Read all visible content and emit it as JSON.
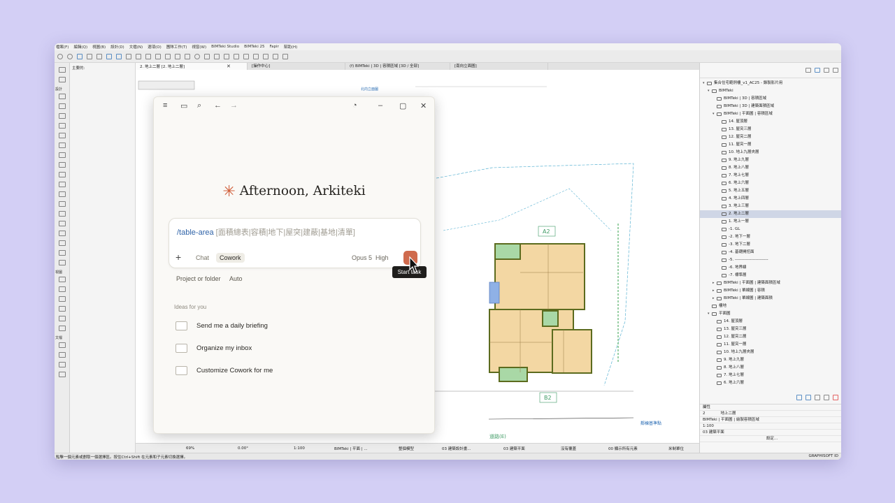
{
  "menubar": [
    "檔案(F)",
    "編輯(Q)",
    "視圖(B)",
    "設計(D)",
    "文檔(N)",
    "選項(O)",
    "團隊工作(T)",
    "視窗(W)",
    "BIMTeki Studio",
    "BIMTeki 25",
    "Fapir",
    "幫助(H)"
  ],
  "tabs": {
    "view_tab": "2. 地上二層 [2. 地上二層]",
    "tab_action": "[操作中心]",
    "tab_3d": "(f) BIMTeki | 3D | 容積區域 [3D / 全部]",
    "tab_elevation": "[南向立面圖]"
  },
  "infobox": {
    "title": "主要的:"
  },
  "left_palette_labels": [
    "設計",
    "文檔",
    "視圖"
  ],
  "canvas": {
    "elevation_marker": "北向立面圖",
    "labels": [
      "A2",
      "B2",
      "鄰棟基準點",
      "道路(E)"
    ]
  },
  "right_panel": {
    "project": "集合住宅範例樓_v1_AC25 - 錄製影片用",
    "tree": [
      {
        "label": "BIMTeki",
        "indent": 1,
        "arrow": "▾"
      },
      {
        "label": "BIMTeki | 3D | 容積區域",
        "indent": 2,
        "arrow": ""
      },
      {
        "label": "BIMTeki | 3D | 建築面積區域",
        "indent": 2,
        "arrow": ""
      },
      {
        "label": "BIMTeki | 平面圖 | 容積區域",
        "indent": 2,
        "arrow": "▾"
      },
      {
        "label": "14. 屋頂層",
        "indent": 3,
        "arrow": ""
      },
      {
        "label": "13. 屋突三層",
        "indent": 3,
        "arrow": ""
      },
      {
        "label": "12. 屋突二層",
        "indent": 3,
        "arrow": ""
      },
      {
        "label": "11. 屋突一層",
        "indent": 3,
        "arrow": ""
      },
      {
        "label": "10. 地上九層夾層",
        "indent": 3,
        "arrow": ""
      },
      {
        "label": "9. 地上九層",
        "indent": 3,
        "arrow": ""
      },
      {
        "label": "8. 地上八層",
        "indent": 3,
        "arrow": ""
      },
      {
        "label": "7. 地上七層",
        "indent": 3,
        "arrow": ""
      },
      {
        "label": "6. 地上六層",
        "indent": 3,
        "arrow": ""
      },
      {
        "label": "5. 地上五層",
        "indent": 3,
        "arrow": ""
      },
      {
        "label": "4. 地上四層",
        "indent": 3,
        "arrow": ""
      },
      {
        "label": "3. 地上三層",
        "indent": 3,
        "arrow": ""
      },
      {
        "label": "2. 地上二層",
        "indent": 3,
        "arrow": "",
        "selected": true
      },
      {
        "label": "1. 地上一層",
        "indent": 3,
        "arrow": ""
      },
      {
        "label": "-1. GL",
        "indent": 3,
        "arrow": ""
      },
      {
        "label": "-2. 地下一層",
        "indent": 3,
        "arrow": ""
      },
      {
        "label": "-3. 地下二層",
        "indent": 3,
        "arrow": ""
      },
      {
        "label": "-4. 基礎開挖面",
        "indent": 3,
        "arrow": ""
      },
      {
        "label": "-5. ------------------------",
        "indent": 3,
        "arrow": ""
      },
      {
        "label": "-6. 地界線",
        "indent": 3,
        "arrow": ""
      },
      {
        "label": "-7. 標準層",
        "indent": 3,
        "arrow": ""
      },
      {
        "label": "BIMTeki | 平面圖 | 建築面積區域",
        "indent": 2,
        "arrow": "▸"
      },
      {
        "label": "BIMTeki | 單線圖 | 容積",
        "indent": 2,
        "arrow": "▸"
      },
      {
        "label": "BIMTeki | 單線圖 | 建築面積",
        "indent": 2,
        "arrow": "▸"
      },
      {
        "label": "樓地",
        "indent": 1,
        "arrow": ""
      },
      {
        "label": "平面圖",
        "indent": 1,
        "arrow": "▾"
      },
      {
        "label": "14. 屋頂層",
        "indent": 2,
        "arrow": ""
      },
      {
        "label": "13. 屋突三層",
        "indent": 2,
        "arrow": ""
      },
      {
        "label": "12. 屋突二層",
        "indent": 2,
        "arrow": ""
      },
      {
        "label": "11. 屋突一層",
        "indent": 2,
        "arrow": ""
      },
      {
        "label": "10. 地上九層夾層",
        "indent": 2,
        "arrow": ""
      },
      {
        "label": "9. 地上九層",
        "indent": 2,
        "arrow": ""
      },
      {
        "label": "8. 地上八層",
        "indent": 2,
        "arrow": ""
      },
      {
        "label": "7. 地上七層",
        "indent": 2,
        "arrow": ""
      },
      {
        "label": "6. 地上六層",
        "indent": 2,
        "arrow": ""
      },
      {
        "label": "5. 地上五層",
        "indent": 2,
        "arrow": ""
      }
    ],
    "props_title": "屬性",
    "props": {
      "id": "2",
      "name": "地上二層",
      "view": "BIMTeki | 平面圖 | 繪製容積區域",
      "scale": "1:100",
      "layer": "03 建築平面",
      "settings": "設定..."
    }
  },
  "statusbar": {
    "zoom": "69%",
    "angle": "0.00°",
    "scale": "1:100",
    "view_set": "BIMTeki | 平面 | ...",
    "model": "整個模型",
    "layer_combo": "03 建築設計畫...",
    "pen_set": "03 建築平面",
    "override": "沒有覆蓋",
    "renovation": "00 顯示所有元素",
    "unit": "米制單位",
    "hint": "點擊一個元素或劃取一個選擇區。按住Ctrl+Shift 在元素和子元素切換選擇。",
    "brand": "GRAPHISOFT ID"
  },
  "claude": {
    "greeting": "Afternoon, Arkiteki",
    "prompt_command": "/table-area",
    "prompt_args": " [面積總表|容積|地下|屋突|建蔽|基地|清單]",
    "mode_chat": "Chat",
    "mode_cowork": "Cowork",
    "model": "Opus 5",
    "effort": "High",
    "tooltip": "Start task",
    "project_label": "Project or folder",
    "project_value": "Auto",
    "ideas_heading": "Ideas for you",
    "ideas": [
      "Send me a daily briefing",
      "Organize my inbox",
      "Customize Cowork for me"
    ],
    "accent": "#d1613d"
  }
}
